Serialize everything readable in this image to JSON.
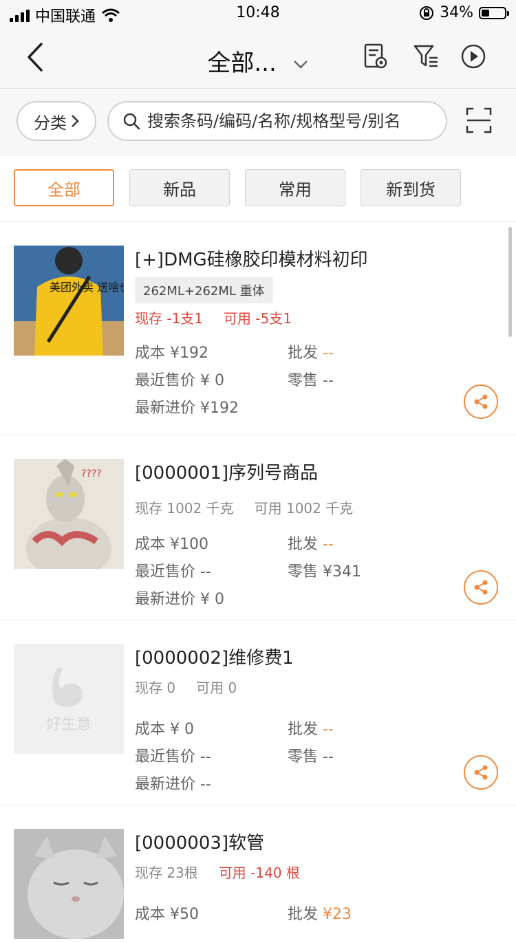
{
  "status": {
    "carrier": "中国联通",
    "time": "10:48",
    "battery": "34%",
    "battery_level": 0.34
  },
  "nav": {
    "title": "全部..."
  },
  "search": {
    "category_label": "分类",
    "placeholder": "搜索条码/编码/名称/规格型号/别名"
  },
  "filters": [
    {
      "label": "全部",
      "active": true
    },
    {
      "label": "新品",
      "active": false
    },
    {
      "label": "常用",
      "active": false
    },
    {
      "label": "新到货",
      "active": false
    }
  ],
  "products": [
    {
      "title": "[+]DMG硅橡胶印模材料初印",
      "spec": "262ML+262ML 重体",
      "stock": "现存 -1支1",
      "available": "可用 -5支1",
      "cost": "成本 ¥192",
      "wholesale_label": "批发",
      "wholesale_value": "--",
      "recent_sale": "最近售价 ¥ 0",
      "retail": "零售 --",
      "latest_purchase": "最新进价 ¥192",
      "image_text": "美团外卖 送啥也快"
    },
    {
      "title": "[0000001]序列号商品",
      "stock": "现存 1002 千克",
      "available": "可用 1002 千克",
      "cost": "成本 ¥100",
      "wholesale_label": "批发",
      "wholesale_value": "--",
      "recent_sale": "最近售价 --",
      "retail": "零售 ¥341",
      "latest_purchase": "最新进价 ¥ 0",
      "image_text": "????"
    },
    {
      "title": "[0000002]维修费1",
      "stock": "现存 0",
      "available": "可用 0",
      "cost": "成本 ¥ 0",
      "wholesale_label": "批发",
      "wholesale_value": "--",
      "recent_sale": "最近售价 --",
      "retail": "零售 --",
      "latest_purchase": "最新进价 --",
      "image_text": "好生意"
    },
    {
      "title": "[0000003]软管",
      "stock": "现存 23根",
      "available": "可用 -140 根",
      "cost": "成本 ¥50",
      "wholesale_label": "批发",
      "wholesale_value": "¥23"
    }
  ],
  "colors": {
    "accent": "#f08a3c",
    "warning_red": "#e0453a"
  }
}
